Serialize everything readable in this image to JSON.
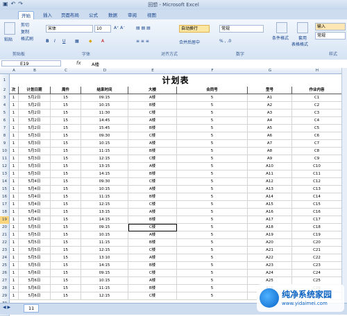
{
  "window": {
    "title": "回想 - Microsoft Excel"
  },
  "tabs": [
    "开始",
    "插入",
    "页面布局",
    "公式",
    "数据",
    "审阅",
    "视图"
  ],
  "ribbon": {
    "paste": "粘贴",
    "cut": "剪切",
    "copy": "复制",
    "format_painter": "格式刷",
    "font_name": "宋体",
    "font_size": "10",
    "wrap": "自动换行",
    "merge": "合并后居中",
    "number_format": "常规",
    "cond_format": "条件格式",
    "use": "套用",
    "table_format": "表格格式",
    "input": "输入",
    "normal": "常规",
    "groups": {
      "clipboard": "剪贴板",
      "font": "字体",
      "align": "对齐方式",
      "number": "数字",
      "style": "样式"
    }
  },
  "formula_bar": {
    "name_box": "E19",
    "fx": "fx",
    "value": "A楼"
  },
  "columns": [
    "A",
    "B",
    "C",
    "D",
    "E",
    "F",
    "G",
    "H"
  ],
  "sheet": {
    "title": "计划表",
    "headers": [
      "次",
      "计划日期",
      "周件",
      "结束时间",
      "大楼",
      "合同号",
      "型号",
      "作业内容"
    ],
    "rows": [
      [
        "1",
        "5月2日",
        "15",
        "09:15",
        "A楼",
        "5",
        "A1",
        "C1"
      ],
      [
        "1",
        "5月2日",
        "15",
        "10:15",
        "B楼",
        "5",
        "A2",
        "C2"
      ],
      [
        "1",
        "5月2日",
        "15",
        "11:30",
        "C楼",
        "5",
        "A3",
        "C3"
      ],
      [
        "1",
        "5月2日",
        "15",
        "14:45",
        "A楼",
        "5",
        "A4",
        "C4"
      ],
      [
        "1",
        "5月2日",
        "15",
        "15:45",
        "B楼",
        "5",
        "A5",
        "C5"
      ],
      [
        "1",
        "5月3日",
        "15",
        "09:30",
        "C楼",
        "5",
        "A6",
        "C6"
      ],
      [
        "1",
        "5月3日",
        "15",
        "10:15",
        "A楼",
        "5",
        "A7",
        "C7"
      ],
      [
        "1",
        "5月3日",
        "15",
        "11:15",
        "B楼",
        "5",
        "A8",
        "C8"
      ],
      [
        "1",
        "5月3日",
        "15",
        "12:15",
        "C楼",
        "5",
        "A9",
        "C9"
      ],
      [
        "1",
        "5月3日",
        "15",
        "13:15",
        "A楼",
        "5",
        "A10",
        "C10"
      ],
      [
        "1",
        "5月3日",
        "15",
        "14:15",
        "B楼",
        "5",
        "A11",
        "C11"
      ],
      [
        "1",
        "5月4日",
        "15",
        "09:30",
        "C楼",
        "5",
        "A12",
        "C12"
      ],
      [
        "1",
        "5月4日",
        "15",
        "10:15",
        "A楼",
        "5",
        "A13",
        "C13"
      ],
      [
        "1",
        "5月4日",
        "15",
        "11:15",
        "B楼",
        "5",
        "A14",
        "C14"
      ],
      [
        "1",
        "5月4日",
        "15",
        "12:15",
        "C楼",
        "5",
        "A15",
        "C15"
      ],
      [
        "1",
        "5月4日",
        "15",
        "13:15",
        "A楼",
        "5",
        "A16",
        "C16"
      ],
      [
        "1",
        "5月4日",
        "15",
        "14:15",
        "B楼",
        "5",
        "A17",
        "C17"
      ],
      [
        "1",
        "5月5日",
        "15",
        "09:15",
        "C楼",
        "5",
        "A18",
        "C18"
      ],
      [
        "1",
        "5月5日",
        "15",
        "10:15",
        "A楼",
        "5",
        "A19",
        "C19"
      ],
      [
        "1",
        "5月5日",
        "15",
        "11:15",
        "B楼",
        "5",
        "A20",
        "C20"
      ],
      [
        "1",
        "5月5日",
        "15",
        "12:15",
        "C楼",
        "5",
        "A21",
        "C21"
      ],
      [
        "1",
        "5月5日",
        "15",
        "13:10",
        "A楼",
        "5",
        "A22",
        "C22"
      ],
      [
        "1",
        "5月5日",
        "15",
        "14:15",
        "B楼",
        "5",
        "A23",
        "C23"
      ],
      [
        "1",
        "5月6日",
        "15",
        "09:15",
        "C楼",
        "5",
        "A24",
        "C24"
      ],
      [
        "1",
        "5月6日",
        "15",
        "10:15",
        "A楼",
        "5",
        "A25",
        "C25"
      ],
      [
        "1",
        "5月6日",
        "15",
        "11:15",
        "B楼",
        "5",
        "A26",
        "C26"
      ],
      [
        "1",
        "5月6日",
        "15",
        "12:15",
        "C楼",
        "5",
        "A27",
        "C27"
      ]
    ]
  },
  "row_numbers": [
    "1",
    "2",
    "3",
    "4",
    "5",
    "6",
    "7",
    "8",
    "9",
    "10",
    "11",
    "12",
    "13",
    "14",
    "15",
    "16",
    "17",
    "18",
    "19",
    "20",
    "21",
    "22",
    "23",
    "24",
    "25",
    "26",
    "27",
    "28",
    "29",
    "30",
    "31"
  ],
  "sheet_tab": "11",
  "watermark": {
    "name": "纯净系统家园",
    "url": "www.yidaimei.com"
  }
}
